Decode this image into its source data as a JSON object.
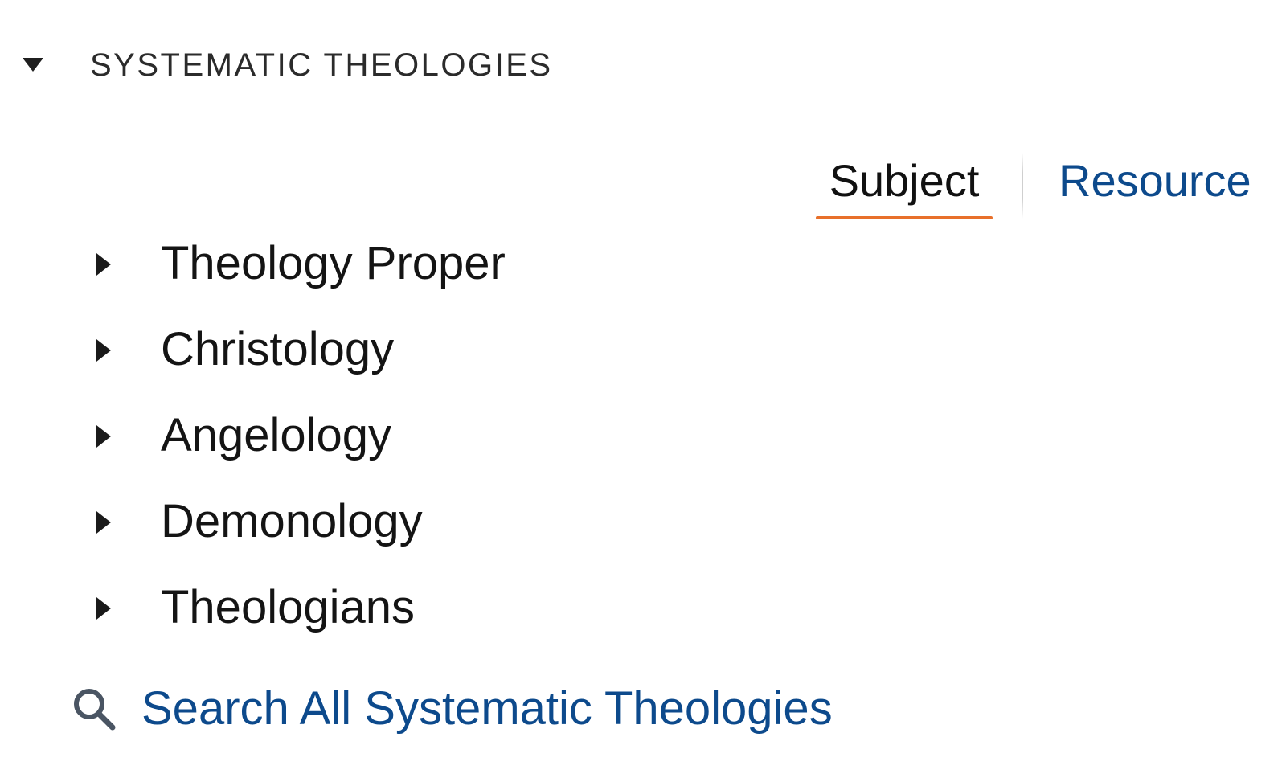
{
  "section": {
    "title": "SYSTEMATIC THEOLOGIES",
    "collapse_icon": "caret-down-icon"
  },
  "tabs": {
    "subject_label": "Subject",
    "resource_label": "Resource",
    "active": "Subject",
    "active_underline_color": "#e8702a"
  },
  "subjects": {
    "items": [
      {
        "label": "Theology Proper",
        "icon": "caret-right-icon"
      },
      {
        "label": "Christology",
        "icon": "caret-right-icon"
      },
      {
        "label": "Angelology",
        "icon": "caret-right-icon"
      },
      {
        "label": "Demonology",
        "icon": "caret-right-icon"
      },
      {
        "label": "Theologians",
        "icon": "caret-right-icon"
      }
    ]
  },
  "search": {
    "label": "Search All Systematic Theologies",
    "icon": "search-icon"
  },
  "colors": {
    "link": "#0d4a8c",
    "text": "#141414",
    "accent": "#e8702a"
  }
}
